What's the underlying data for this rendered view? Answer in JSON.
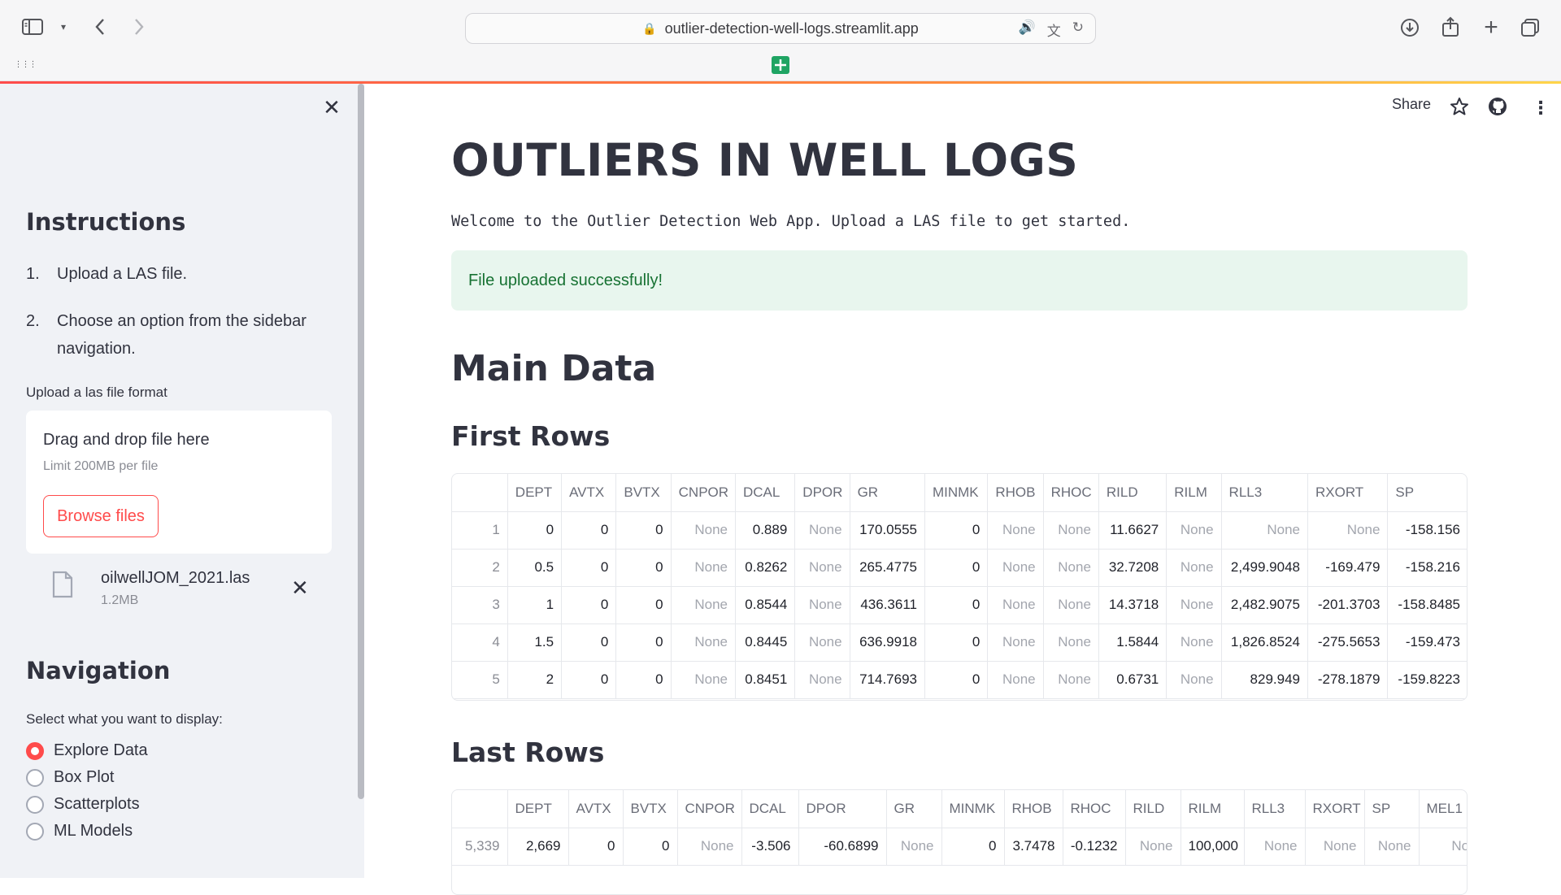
{
  "browser": {
    "url": "outlier-detection-well-logs.streamlit.app",
    "icons": [
      "sidebar-toggle-icon",
      "chevron-down-icon",
      "back-icon",
      "forward-icon",
      "lock-icon",
      "speaker-icon",
      "translate-icon",
      "reload-icon",
      "download-icon",
      "share-icon",
      "new-tab-icon",
      "tabs-overview-icon",
      "grid-icon",
      "sheets-extension-icon"
    ]
  },
  "toolbar": {
    "share_label": "Share"
  },
  "sidebar": {
    "instructions_title": "Instructions",
    "steps": [
      {
        "num": "1.",
        "text": "Upload a LAS file."
      },
      {
        "num": "2.",
        "text": "Choose an option from the sidebar navigation."
      }
    ],
    "upload_label": "Upload a las file format",
    "dropzone_title": "Drag and drop file here",
    "dropzone_limit": "Limit 200MB per file",
    "browse_label": "Browse files",
    "file": {
      "name": "oilwellJOM_2021.las",
      "size": "1.2MB"
    },
    "navigation_title": "Navigation",
    "navigation_prompt": "Select what you want to display:",
    "options": [
      "Explore Data",
      "Box Plot",
      "Scatterplots",
      "ML Models"
    ],
    "selected_option": "Explore Data"
  },
  "main": {
    "title": "OUTLIERS IN WELL LOGS",
    "welcome": "Welcome to the Outlier Detection Web App. Upload a LAS file to get started.",
    "success": "File uploaded successfully!",
    "section_title": "Main Data",
    "first_rows_title": "First Rows",
    "last_rows_title": "Last Rows"
  },
  "first_rows": {
    "columns": [
      "",
      "DEPT",
      "AVTX",
      "BVTX",
      "CNPOR",
      "DCAL",
      "DPOR",
      "GR",
      "MINMK",
      "RHOB",
      "RHOC",
      "RILD",
      "RILM",
      "RLL3",
      "RXORT",
      "SP"
    ],
    "rows": [
      [
        "1",
        "0",
        "0",
        "0",
        "None",
        "0.889",
        "None",
        "170.0555",
        "0",
        "None",
        "None",
        "11.6627",
        "None",
        "None",
        "None",
        "-158.156"
      ],
      [
        "2",
        "0.5",
        "0",
        "0",
        "None",
        "0.8262",
        "None",
        "265.4775",
        "0",
        "None",
        "None",
        "32.7208",
        "None",
        "2,499.9048",
        "-169.479",
        "-158.216"
      ],
      [
        "3",
        "1",
        "0",
        "0",
        "None",
        "0.8544",
        "None",
        "436.3611",
        "0",
        "None",
        "None",
        "14.3718",
        "None",
        "2,482.9075",
        "-201.3703",
        "-158.8485"
      ],
      [
        "4",
        "1.5",
        "0",
        "0",
        "None",
        "0.8445",
        "None",
        "636.9918",
        "0",
        "None",
        "None",
        "1.5844",
        "None",
        "1,826.8524",
        "-275.5653",
        "-159.473"
      ],
      [
        "5",
        "2",
        "0",
        "0",
        "None",
        "0.8451",
        "None",
        "714.7693",
        "0",
        "None",
        "None",
        "0.6731",
        "None",
        "829.949",
        "-278.1879",
        "-159.8223"
      ]
    ]
  },
  "last_rows": {
    "columns": [
      "",
      "DEPT",
      "AVTX",
      "BVTX",
      "CNPOR",
      "DCAL",
      "DPOR",
      "GR",
      "MINMK",
      "RHOB",
      "RHOC",
      "RILD",
      "RILM",
      "RLL3",
      "RXORT",
      "SP",
      "MEL1"
    ],
    "rows": [
      [
        "5,339",
        "2,669",
        "0",
        "0",
        "None",
        "-3.506",
        "-60.6899",
        "None",
        "0",
        "3.7478",
        "-0.1232",
        "None",
        "100,000",
        "None",
        "None",
        "None",
        "Non"
      ]
    ]
  }
}
